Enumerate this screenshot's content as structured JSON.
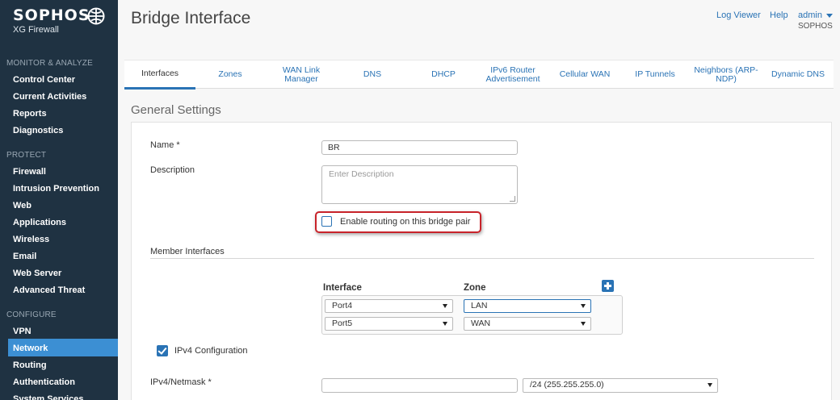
{
  "brand": {
    "name": "SOPHOS",
    "product": "XG Firewall"
  },
  "sidebar": {
    "sections": [
      {
        "title": "MONITOR & ANALYZE",
        "items": [
          "Control Center",
          "Current Activities",
          "Reports",
          "Diagnostics"
        ]
      },
      {
        "title": "PROTECT",
        "items": [
          "Firewall",
          "Intrusion Prevention",
          "Web",
          "Applications",
          "Wireless",
          "Email",
          "Web Server",
          "Advanced Threat"
        ]
      },
      {
        "title": "CONFIGURE",
        "items": [
          "VPN",
          "Network",
          "Routing",
          "Authentication",
          "System Services"
        ]
      }
    ],
    "active_item": "Network"
  },
  "header": {
    "title": "Bridge Interface",
    "links": {
      "log_viewer": "Log Viewer",
      "help": "Help",
      "admin": "admin"
    },
    "admin_org": "SOPHOS"
  },
  "tabs": [
    {
      "label": "Interfaces",
      "active": true
    },
    {
      "label": "Zones",
      "active": false
    },
    {
      "label": "WAN Link Manager",
      "active": false
    },
    {
      "label": "DNS",
      "active": false
    },
    {
      "label": "DHCP",
      "active": false
    },
    {
      "label": "IPv6 Router Advertisement",
      "active": false
    },
    {
      "label": "Cellular WAN",
      "active": false
    },
    {
      "label": "IP Tunnels",
      "active": false
    },
    {
      "label": "Neighbors (ARP-NDP)",
      "active": false
    },
    {
      "label": "Dynamic DNS",
      "active": false
    }
  ],
  "form": {
    "section_title": "General Settings",
    "name_label": "Name *",
    "name_value": "BR",
    "description_label": "Description",
    "description_placeholder": "Enter Description",
    "routing_checkbox_label": "Enable routing on this bridge pair",
    "routing_checked": false,
    "member_interfaces_label": "Member Interfaces",
    "interface_col": "Interface",
    "zone_col": "Zone",
    "members": [
      {
        "interface": "Port4",
        "zone": "LAN"
      },
      {
        "interface": "Port5",
        "zone": "WAN"
      }
    ],
    "ipv4_config_label": "IPv4 Configuration",
    "ipv4_config_checked": true,
    "ipv4_netmask_label": "IPv4/Netmask *",
    "ipv4_value": "",
    "netmask_value": "/24 (255.255.255.0)"
  },
  "colors": {
    "sidebar_bg": "#1f3242",
    "accent": "#2a73b5",
    "active_nav": "#3c8fd3",
    "highlight_border": "#c8232a"
  }
}
